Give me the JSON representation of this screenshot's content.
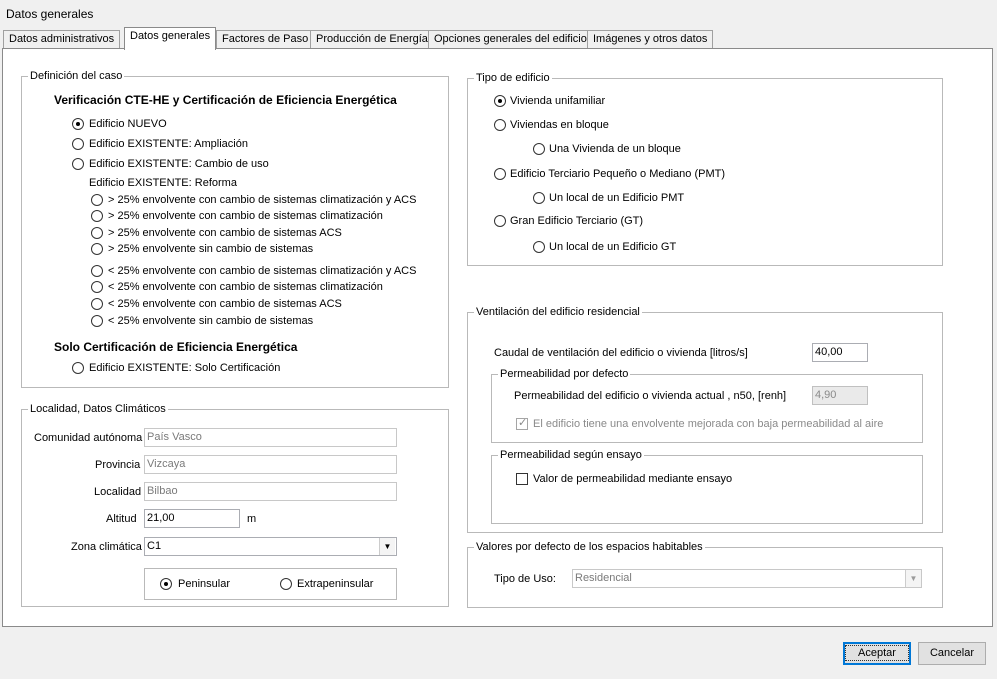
{
  "window": {
    "title": "Datos generales"
  },
  "tabs": [
    {
      "label": "Datos administrativos"
    },
    {
      "label": "Datos generales"
    },
    {
      "label": "Factores de Paso"
    },
    {
      "label": "Producción de Energía"
    },
    {
      "label": "Opciones generales del edificio"
    },
    {
      "label": "Imágenes y otros datos"
    }
  ],
  "definicion": {
    "legend": "Definición del caso",
    "heading_verif": "Verificación CTE-HE y Certificación de Eficiencia Energética",
    "opt_nuevo": "Edificio NUEVO",
    "opt_ampliacion": "Edificio EXISTENTE: Ampliación",
    "opt_cambio_uso": "Edificio EXISTENTE: Cambio de uso",
    "reforma_label": "Edificio EXISTENTE: Reforma",
    "reforma_options": [
      "> 25% envolvente con cambio de sistemas climatización y ACS",
      "> 25% envolvente con cambio de sistemas climatización",
      "> 25% envolvente con cambio de sistemas ACS",
      "> 25% envolvente sin cambio de sistemas",
      "< 25% envolvente con cambio de sistemas climatización y ACS",
      "< 25% envolvente con cambio de sistemas climatización",
      "< 25% envolvente con cambio de sistemas ACS",
      "< 25% envolvente sin cambio de sistemas"
    ],
    "heading_solo": "Solo Certificación de Eficiencia Energética",
    "opt_solo_cert": "Edificio EXISTENTE: Solo Certificación"
  },
  "localidad": {
    "legend": "Localidad, Datos Climáticos",
    "comunidad_label": "Comunidad autónoma",
    "comunidad_value": "País Vasco",
    "provincia_label": "Provincia",
    "provincia_value": "Vizcaya",
    "localidad_label": "Localidad",
    "localidad_value": "Bilbao",
    "altitud_label": "Altitud",
    "altitud_value": "21,00",
    "altitud_unit": "m",
    "zona_label": "Zona climática",
    "zona_value": "C1",
    "peninsular": "Peninsular",
    "extrapeninsular": "Extrapeninsular"
  },
  "tipo_edificio": {
    "legend": "Tipo de edificio",
    "unifamiliar": "Vivienda unifamiliar",
    "bloque": "Viviendas en bloque",
    "una_vivienda": "Una Vivienda de un bloque",
    "pmt": "Edificio Terciario Pequeño o Mediano (PMT)",
    "local_pmt": "Un local de un Edificio PMT",
    "gt": "Gran Edificio Terciario (GT)",
    "local_gt": "Un local de un Edificio GT"
  },
  "ventilacion": {
    "legend": "Ventilación del edificio residencial",
    "caudal_label": "Caudal de ventilación del edificio o vivienda [litros/s]",
    "caudal_value": "40,00",
    "perm_defecto_legend": "Permeabilidad por defecto",
    "perm_label": "Permeabilidad del edificio o vivienda actual , n50, [renh]",
    "perm_value": "4,90",
    "mejorada_label": "El edificio tiene una envolvente mejorada con baja permeabilidad al aire",
    "perm_ensayo_legend": "Permeabilidad según ensayo",
    "ensayo_label": "Valor de permeabilidad mediante ensayo"
  },
  "valores_defecto": {
    "legend": "Valores por defecto de los espacios habitables",
    "tipo_uso_label": "Tipo de Uso:",
    "tipo_uso_value": "Residencial"
  },
  "buttons": {
    "aceptar": "Aceptar",
    "cancelar": "Cancelar"
  }
}
